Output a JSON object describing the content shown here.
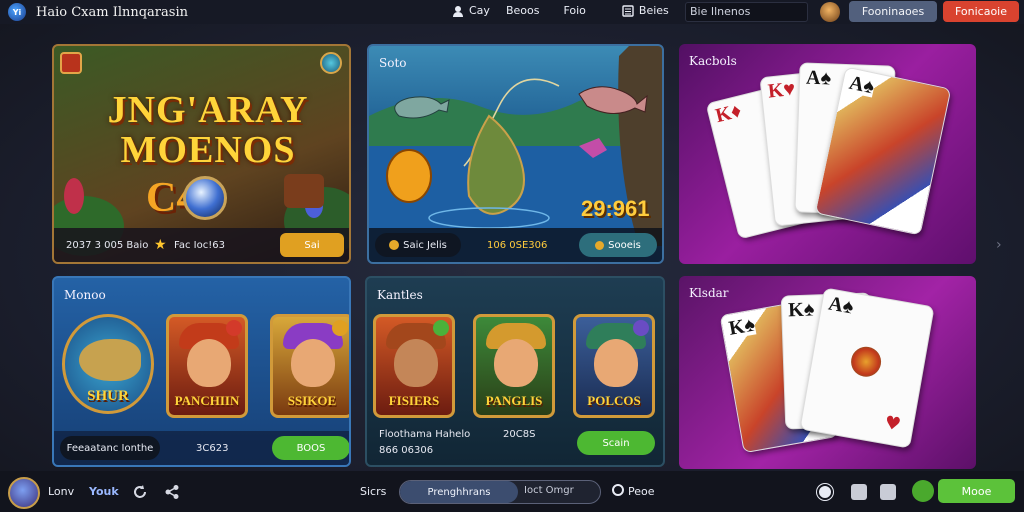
{
  "header": {
    "logo_text": "Yi",
    "title": "Haio Cxam Ilnnqarasin",
    "nav": [
      {
        "label": "Cay",
        "icon": "profile-icon"
      },
      {
        "label": "Beoos",
        "icon": ""
      },
      {
        "label": "Foio",
        "icon": ""
      },
      {
        "label": "Beies",
        "icon": "list-icon"
      }
    ],
    "search_value": "Bie Ilnenos",
    "button_secondary": "Fooninaoes",
    "button_primary": "Fonicaoie"
  },
  "cards": {
    "card1": {
      "title_line1": "JNG'ARAY",
      "title_line2": "MOENOS",
      "title_num": "C4",
      "footer_left": "2037 3 005 Baio",
      "footer_mid": "Fac Ioc!63",
      "button": "Sai"
    },
    "card2": {
      "label": "Soto",
      "big_number": "29:961",
      "footer_left": "Saic Jelis",
      "footer_mid": "106 0SE306",
      "button": "Sooeis"
    },
    "card3": {
      "label": "Kacbols"
    },
    "card4": {
      "label": "Monoo",
      "tiles": [
        "SHUR",
        "PANCHIIN",
        "SSIKOE"
      ],
      "footer_left": "Feeaatanc Ionthe",
      "footer_mid": "3C623",
      "button": "BOOS"
    },
    "card5": {
      "label": "Kantles",
      "tiles": [
        "FISIERS",
        "PANGLIS",
        "POLCOS"
      ],
      "footer_left": "Floothama Hahelo",
      "footer_left2": "866 06306",
      "footer_mid": "20C8S",
      "button": "Scain"
    },
    "card6": {
      "label": "Klsdar"
    }
  },
  "footer": {
    "name": "Lonv",
    "link": "Youk",
    "sort_label": "Sicrs",
    "search_tab": "Prenghhrans",
    "search_placeholder": "Ioct Omgr",
    "page_label": "Peoe",
    "button": "Mooe"
  },
  "colors": {
    "primary_button": "#d9432f",
    "secondary_button": "#52607d",
    "green_button": "#5cc23a",
    "gold_text": "#ffd43a"
  }
}
